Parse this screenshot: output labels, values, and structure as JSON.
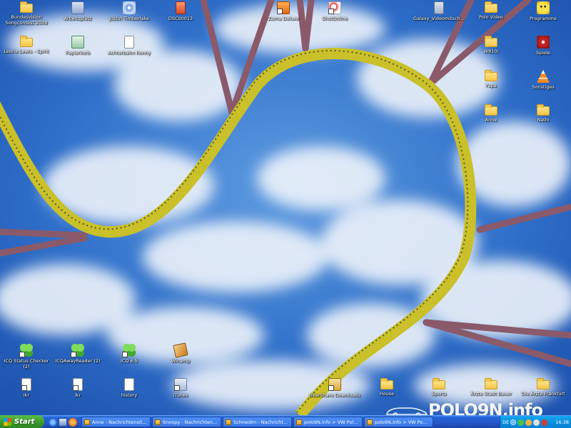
{
  "desktop": {
    "icons": [
      {
        "label": "Bundesvision Songcontest 2008",
        "icon": "folder-icon"
      },
      {
        "label": "Arbeitsplatz",
        "icon": "computer-icon"
      },
      {
        "label": "Justin Timberlake",
        "icon": "disc-icon"
      },
      {
        "label": "DSC00013",
        "icon": "image-file-icon"
      },
      {
        "label": "Zuma Deluxe",
        "icon": "game-icon"
      },
      {
        "label": "ShotOnline",
        "icon": "golf-icon"
      },
      {
        "label": "Galaxy_Videomitsch...",
        "icon": "media-file-icon"
      },
      {
        "label": "Polo Video",
        "icon": "folder-icon"
      },
      {
        "label": "Programme",
        "icon": "face-icon"
      },
      {
        "label": "Leona Lewis - Spirit",
        "icon": "folder-icon"
      },
      {
        "label": "Papierkorb",
        "icon": "recycle-bin-icon"
      },
      {
        "label": "Achterbahn Ronny",
        "icon": "document-icon"
      },
      {
        "label": "W810i",
        "icon": "folder-icon"
      },
      {
        "label": "Spiele",
        "icon": "red-disc-icon"
      },
      {
        "label": "Papa",
        "icon": "folder-icon"
      },
      {
        "label": "Sonstiges",
        "icon": "traffic-cone-icon"
      },
      {
        "label": "Anne",
        "icon": "folder-icon"
      },
      {
        "label": "Nathi",
        "icon": "folder-icon"
      },
      {
        "label": "ICQ Status Checker (2)",
        "icon": "icq-icon"
      },
      {
        "label": "ICQAwayReader (2)",
        "icon": "icq-icon"
      },
      {
        "label": "ICQ 6.5",
        "icon": "icq-icon"
      },
      {
        "label": "Winamp",
        "icon": "winamp-icon"
      },
      {
        "label": "ikr",
        "icon": "shortcut-icon"
      },
      {
        "label": "ikr",
        "icon": "shortcut-icon"
      },
      {
        "label": "history",
        "icon": "document-icon"
      },
      {
        "label": "iTunes",
        "icon": "music-icon"
      },
      {
        "label": "BearShare Downloads",
        "icon": "bearshare-icon"
      },
      {
        "label": "House",
        "icon": "folder-icon"
      },
      {
        "label": "Sports",
        "icon": "folder-icon"
      },
      {
        "label": "Ärzte Stadt Bauer",
        "icon": "folder-icon"
      },
      {
        "label": "Die Ärzte Frankfurt",
        "icon": "folder-icon"
      }
    ]
  },
  "taskbar": {
    "start_label": "Start",
    "quicklaunch": [
      "internet-explorer-icon",
      "show-desktop-icon",
      "media-player-icon"
    ],
    "tasks": [
      {
        "label": "Anne - Nachrichtensit..."
      },
      {
        "label": "Snoopy - Nachrichten..."
      },
      {
        "label": "Schneidm - Nachricht..."
      },
      {
        "label": "polo9N.info > VW Pol..."
      },
      {
        "label": "polo9N.info > VW Po..."
      }
    ],
    "tray": {
      "language": "DE",
      "clock": "16:38"
    }
  },
  "watermark": {
    "text": "POLO9N.info"
  },
  "colors": {
    "sky": "#3f7fd0",
    "track": "#c9c02a",
    "taskbar": "#2356c8",
    "start": "#3a9a2b",
    "tray": "#0d8fe0"
  }
}
